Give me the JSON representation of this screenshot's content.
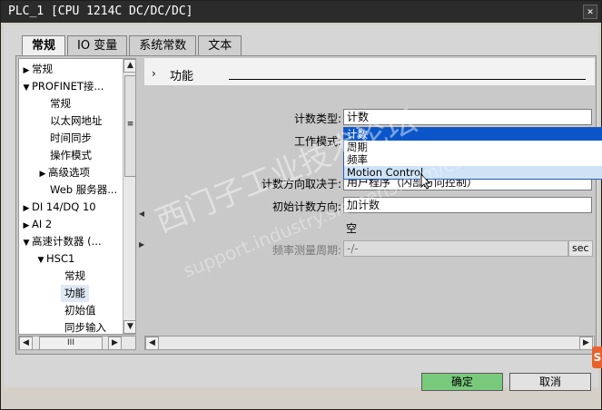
{
  "window": {
    "title": "PLC_1 [CPU 1214C DC/DC/DC]",
    "close": "✕"
  },
  "tabs": [
    {
      "label": "常规"
    },
    {
      "label": "IO 变量"
    },
    {
      "label": "系统常数"
    },
    {
      "label": "文本"
    }
  ],
  "tree": {
    "items": [
      {
        "arrow": "▶",
        "label": "常规"
      },
      {
        "arrow": "▼",
        "label": "PROFINET接..."
      },
      {
        "arrow": "",
        "label": "常规"
      },
      {
        "arrow": "",
        "label": "以太网地址"
      },
      {
        "arrow": "",
        "label": "时间同步"
      },
      {
        "arrow": "",
        "label": "操作模式"
      },
      {
        "arrow": "▶",
        "label": "高级选项"
      },
      {
        "arrow": "",
        "label": "Web 服务器..."
      },
      {
        "arrow": "▶",
        "label": "DI 14/DQ 10"
      },
      {
        "arrow": "▶",
        "label": "AI 2"
      },
      {
        "arrow": "▼",
        "label": "高速计数器 (..."
      },
      {
        "arrow": "▼",
        "label": "HSC1"
      },
      {
        "arrow": "",
        "label": "常规"
      },
      {
        "arrow": "",
        "label": "功能"
      },
      {
        "arrow": "",
        "label": "初始值"
      },
      {
        "arrow": "",
        "label": "同步输入"
      }
    ],
    "selected_index": 13,
    "scroll_up": "▲",
    "scroll_down": "▼",
    "scroll_left": "◀",
    "scroll_right": "▶",
    "thumb_grip": "≡",
    "hthumb_grip": "III"
  },
  "panel": {
    "chevron": "›",
    "section_title": "功能",
    "count_type_label": "计数类型:",
    "count_type_value": "计数",
    "work_mode_label": "工作模式:",
    "dropdown_options": [
      "计数",
      "周期",
      "频率",
      "Motion Control"
    ],
    "dropdown_highlighted": 0,
    "dropdown_hover": 3,
    "direction_label": "计数方向取决于:",
    "direction_value": "用户程序（内部方向控制）",
    "initial_dir_label": "初始计数方向:",
    "initial_dir_value": "加计数",
    "empty_text": "空",
    "freq_period_label": "频率测量周期:",
    "freq_period_value": "-/-",
    "freq_period_unit": "sec"
  },
  "watermark": {
    "line1": "西门子工业技术论坛",
    "line2": "support.industry.siemens.com/cs"
  },
  "buttons": {
    "ok": "确定",
    "cancel": "取消"
  },
  "badge": "S"
}
